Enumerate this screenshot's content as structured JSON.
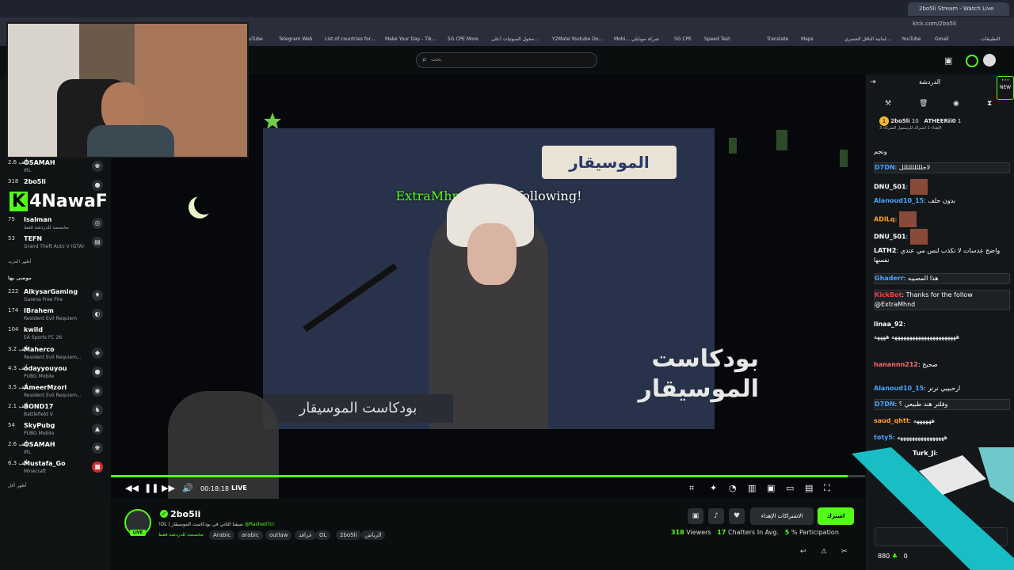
{
  "browser": {
    "active_tab": "2bo5li Stream - Watch Live",
    "url": "kick.com/2bo5li",
    "bookmarks": [
      "uTube",
      "Telegram Web",
      "List of countries for...",
      "Make Your Day - Tik...",
      "5G CPE More",
      "محول الصوتيات (على...",
      "Y2Mate Youtube Do...",
      "Mobi... شركة موبايلي",
      "5G CPE",
      "Speed Test",
      "Translate",
      "Maps",
      "لمانية الناقل الحصري...",
      "YouTube",
      "Gmail",
      "التطبيقات"
    ]
  },
  "header": {
    "search_placeholder": "بحث"
  },
  "sidebar": {
    "top_items": [
      {
        "viewers": "2.6 ألف",
        "name": "OSAMAH",
        "game": "IRL"
      },
      {
        "viewers": "318",
        "name": "2bo5li",
        "game": ""
      },
      {
        "viewers": "75",
        "name": "Isalman",
        "game": "مخصصة للدردشة فقط"
      },
      {
        "viewers": "53",
        "name": "TEFN",
        "game": "Grand Theft Auto V (GTA)"
      }
    ],
    "show_more_1": "أظهر المزيد",
    "recommended_label": "موصى بها",
    "recommended": [
      {
        "viewers": "222",
        "name": "AlkysarGaming",
        "game": "Garena Free Fire"
      },
      {
        "viewers": "174",
        "name": "IBrahem",
        "game": "Resident Evil Requiem"
      },
      {
        "viewers": "104",
        "name": "kwild",
        "game": "EA Sports FC 26"
      },
      {
        "viewers": "3.2 ألف",
        "name": "Maherco",
        "game": "Resident Evil Requiem..."
      },
      {
        "viewers": "4.3 ألف",
        "name": "odayyouyou",
        "game": "PUBG Mobile"
      },
      {
        "viewers": "3.5 ألف",
        "name": "AmeerMzori",
        "game": "Resident Evil Requiem..."
      },
      {
        "viewers": "2.1 ألف",
        "name": "BOND17",
        "game": "Battlefield V"
      },
      {
        "viewers": "54",
        "name": "SkyPubg",
        "game": "PUBG Mobile"
      },
      {
        "viewers": "2.6 ألف",
        "name": "OSAMAH",
        "game": "IRL"
      },
      {
        "viewers": "6.3 ألف",
        "name": "Mustafa_Go",
        "game": "Minecraft"
      }
    ],
    "show_more_2": "أظهر أقل"
  },
  "overlay": {
    "k4nawaf": "4NawaF",
    "follow_name": "ExtraMhnd",
    "follow_text": " is now following!",
    "logo": "الموسيقار",
    "banner": "بودكاست الموسيقار",
    "brand": "بودكاست الموسيقار"
  },
  "player": {
    "time": "00:18:18",
    "live": "LIVE",
    "progress": 0.977
  },
  "stream": {
    "channel": "2bo5li",
    "title": "!OL | ضيفنا الثاني في بودكاست الموسيقار",
    "mention": "@Rashed7cr",
    "category": "مخصصة للدردشة فقط",
    "tags": [
      "Arabic",
      "arabic",
      "outlaw",
      "غرافد",
      "OL",
      "2bo5li",
      "الرياض"
    ],
    "follow_label": "اشترك",
    "subs_label": "الاشتراكات الإهداء",
    "viewers": "318",
    "viewers_label": "Viewers",
    "chatters": "17",
    "chatters_label": "Chatters In Avg.",
    "participation": "5",
    "participation_label": "% Participation"
  },
  "chat": {
    "title": "الدردشة",
    "new_label": "NEW",
    "pinned": {
      "user1": "2bo5li",
      "count1": "10",
      "user2": "ATHEERii0",
      "count2": "1",
      "note": "الإهداء 1 اشتراك للرسمول الشركاء 3"
    },
    "messages": [
      {
        "user": "",
        "text": "ونجم",
        "color": "#ffffff"
      },
      {
        "user": "D7DN",
        "text": ": لاحلللللللللل",
        "color": "#4aa3ff"
      },
      {
        "user": "DNU_501",
        "text": ":",
        "color": "#ffffff"
      },
      {
        "user": "Alanoud10_15",
        "text": ": بدون حلف",
        "color": "#4aa3ff"
      },
      {
        "user": "ADILq",
        "text": ":",
        "color": "#ff9d2e"
      },
      {
        "user": "DNU_501",
        "text": ":",
        "color": "#ffffff"
      },
      {
        "user": "LATH2",
        "text": ": واضح عدسات لا تكذب لنس مي عندي نفسها",
        "color": "#ffffff"
      },
      {
        "user": "Ghaderr",
        "text": ": هذا المصيبه",
        "color": "#4aa3ff"
      },
      {
        "user": "KickBot",
        "text": ": Thanks for the follow @ExtraMhnd",
        "color": "#ff3b3b"
      },
      {
        "user": "linaa_92",
        "text": ":",
        "color": "#ffffff"
      },
      {
        "user": "",
        "text": "ههههههههههههههههههههههه ههههه",
        "color": "#ffffff"
      },
      {
        "user": "hanannn212",
        "text": ": صحيح",
        "color": "#ff6a6a"
      },
      {
        "user": "Alanoud10_15",
        "text": ": ارحبييي نرنر",
        "color": "#4aa3ff"
      },
      {
        "user": "D7DN",
        "text": ": وفلتر هند طبيعي ؟",
        "color": "#4aa3ff"
      },
      {
        "user": "saud_qhtt",
        "text": ": ههههههه",
        "color": "#ff9d2e"
      },
      {
        "user": "toty5",
        "text": ": ههههههههههههههههه",
        "color": "#4aa3ff"
      },
      {
        "user": "Turk_Ji",
        "text": ":",
        "color": "#ffffff"
      }
    ],
    "points": "880",
    "zero": "0"
  },
  "colors": {
    "accent": "#53fc18",
    "chat_bg": "#141719",
    "page_bg": "#0b0e0f",
    "cyan_overlay": "#1ad0d8"
  }
}
